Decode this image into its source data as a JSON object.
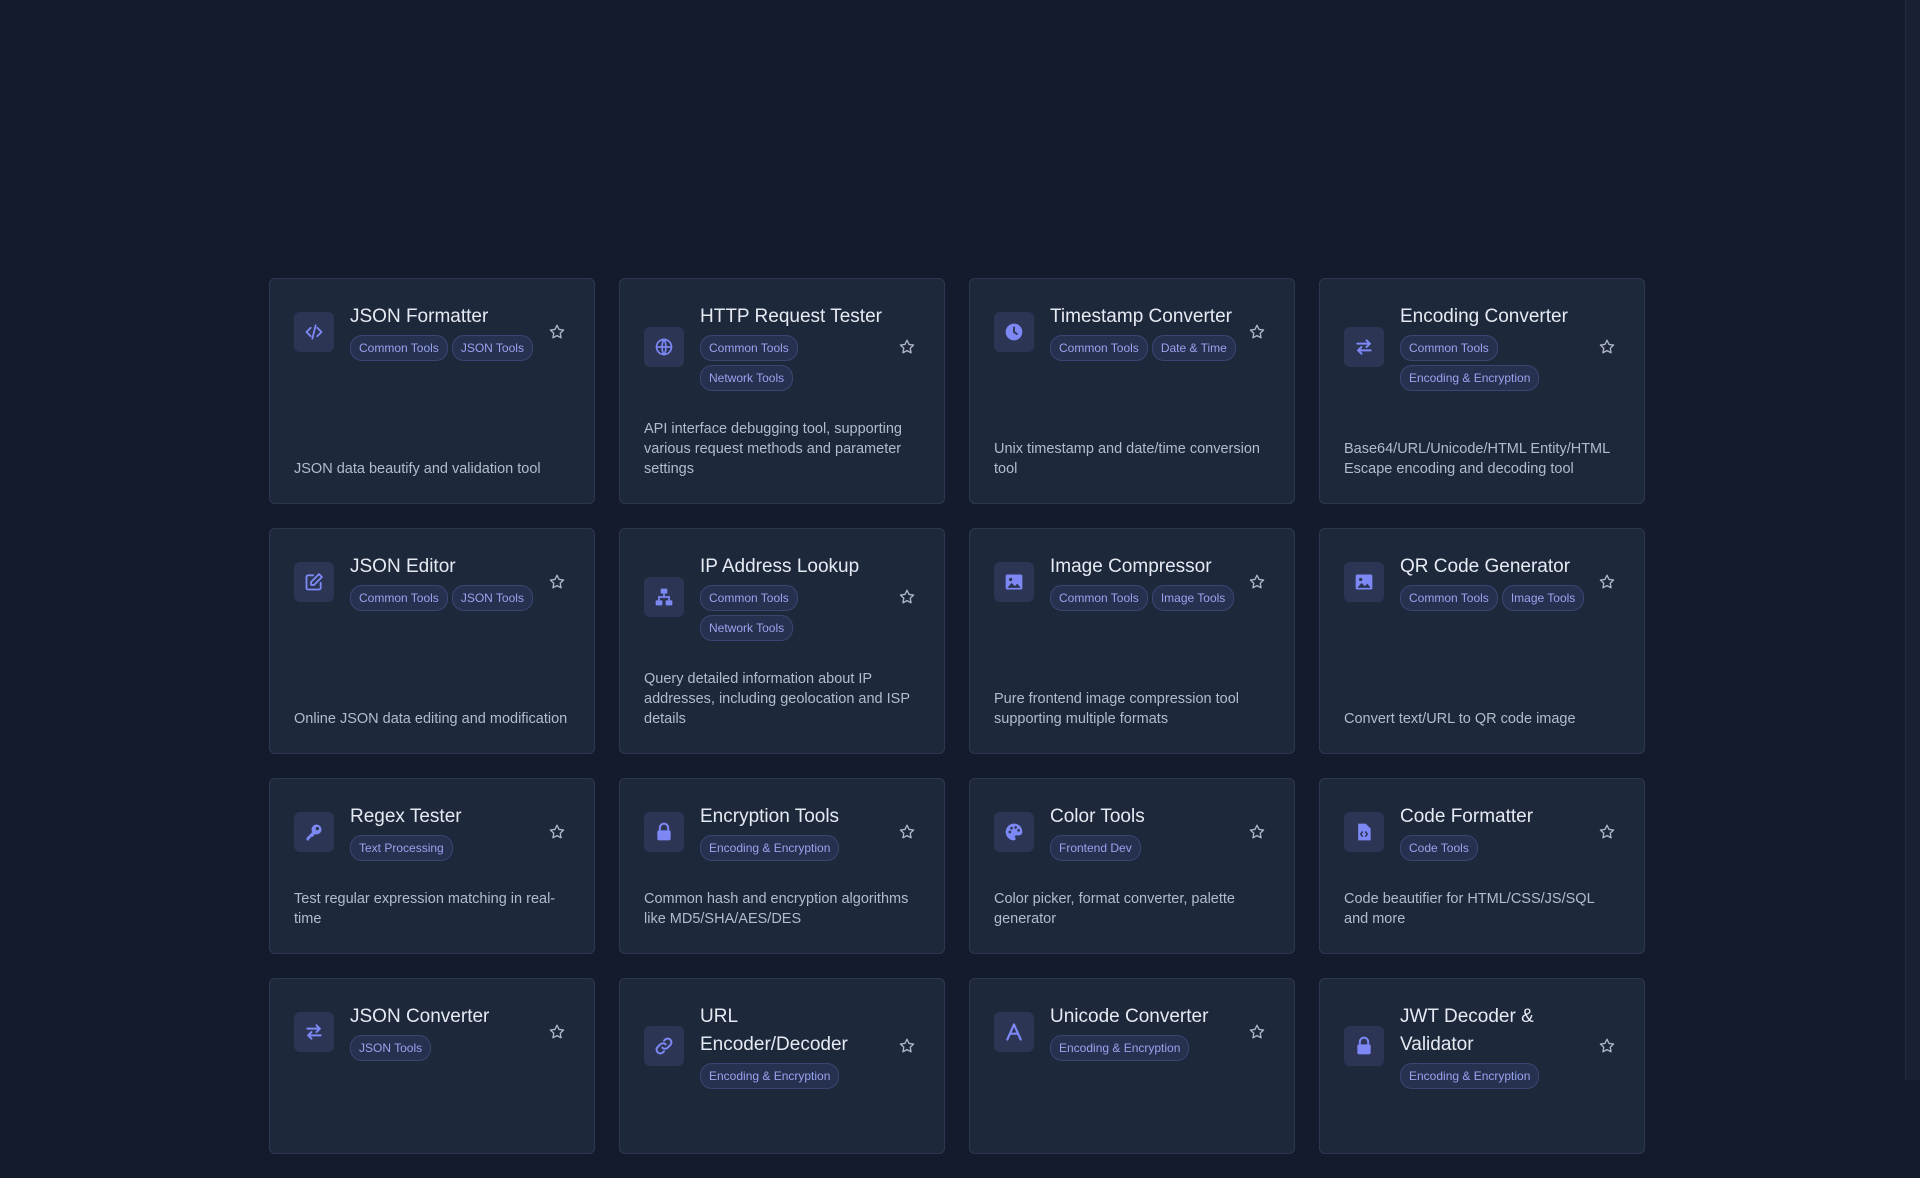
{
  "colors": {
    "accent": "#7d88f5",
    "card_bg": "#1e283b",
    "page_bg": "#141b2d"
  },
  "tools": [
    {
      "title": "JSON Formatter",
      "icon": "code-icon",
      "tags": [
        "Common Tools",
        "JSON Tools"
      ],
      "desc": "JSON data beautify and validation tool"
    },
    {
      "title": "HTTP Request Tester",
      "icon": "globe-icon",
      "tags": [
        "Common Tools",
        "Network Tools"
      ],
      "desc": "API interface debugging tool, supporting various request methods and parameter settings"
    },
    {
      "title": "Timestamp Converter",
      "icon": "clock-icon",
      "tags": [
        "Common Tools",
        "Date & Time"
      ],
      "desc": "Unix timestamp and date/time conversion tool"
    },
    {
      "title": "Encoding Converter",
      "icon": "swap-icon",
      "tags": [
        "Common Tools",
        "Encoding & Encryption"
      ],
      "desc": "Base64/URL/Unicode/HTML Entity/HTML Escape encoding and decoding tool"
    },
    {
      "title": "JSON Editor",
      "icon": "edit-icon",
      "tags": [
        "Common Tools",
        "JSON Tools"
      ],
      "desc": "Online JSON data editing and modification"
    },
    {
      "title": "IP Address Lookup",
      "icon": "network-icon",
      "tags": [
        "Common Tools",
        "Network Tools"
      ],
      "desc": "Query detailed information about IP addresses, including geolocation and ISP details"
    },
    {
      "title": "Image Compressor",
      "icon": "image-icon",
      "tags": [
        "Common Tools",
        "Image Tools"
      ],
      "desc": "Pure frontend image compression tool supporting multiple formats"
    },
    {
      "title": "QR Code Generator",
      "icon": "image-icon",
      "tags": [
        "Common Tools",
        "Image Tools"
      ],
      "desc": "Convert text/URL to QR code image"
    },
    {
      "title": "Regex Tester",
      "icon": "key-icon",
      "tags": [
        "Text Processing"
      ],
      "desc": "Test regular expression matching in real-time"
    },
    {
      "title": "Encryption Tools",
      "icon": "lock-icon",
      "tags": [
        "Encoding & Encryption"
      ],
      "desc": "Common hash and encryption algorithms like MD5/SHA/AES/DES"
    },
    {
      "title": "Color Tools",
      "icon": "palette-icon",
      "tags": [
        "Frontend Dev"
      ],
      "desc": "Color picker, format converter, palette generator"
    },
    {
      "title": "Code Formatter",
      "icon": "file-code-icon",
      "tags": [
        "Code Tools"
      ],
      "desc": "Code beautifier for HTML/CSS/JS/SQL and more"
    },
    {
      "title": "JSON Converter",
      "icon": "swap-icon",
      "tags": [
        "JSON Tools"
      ],
      "desc": ""
    },
    {
      "title": "URL Encoder/Decoder",
      "icon": "link-icon",
      "tags": [
        "Encoding & Encryption"
      ],
      "desc": ""
    },
    {
      "title": "Unicode Converter",
      "icon": "font-icon",
      "tags": [
        "Encoding & Encryption"
      ],
      "desc": ""
    },
    {
      "title": "JWT Decoder & Validator",
      "icon": "lock-icon",
      "tags": [
        "Encoding & Encryption"
      ],
      "desc": ""
    }
  ]
}
